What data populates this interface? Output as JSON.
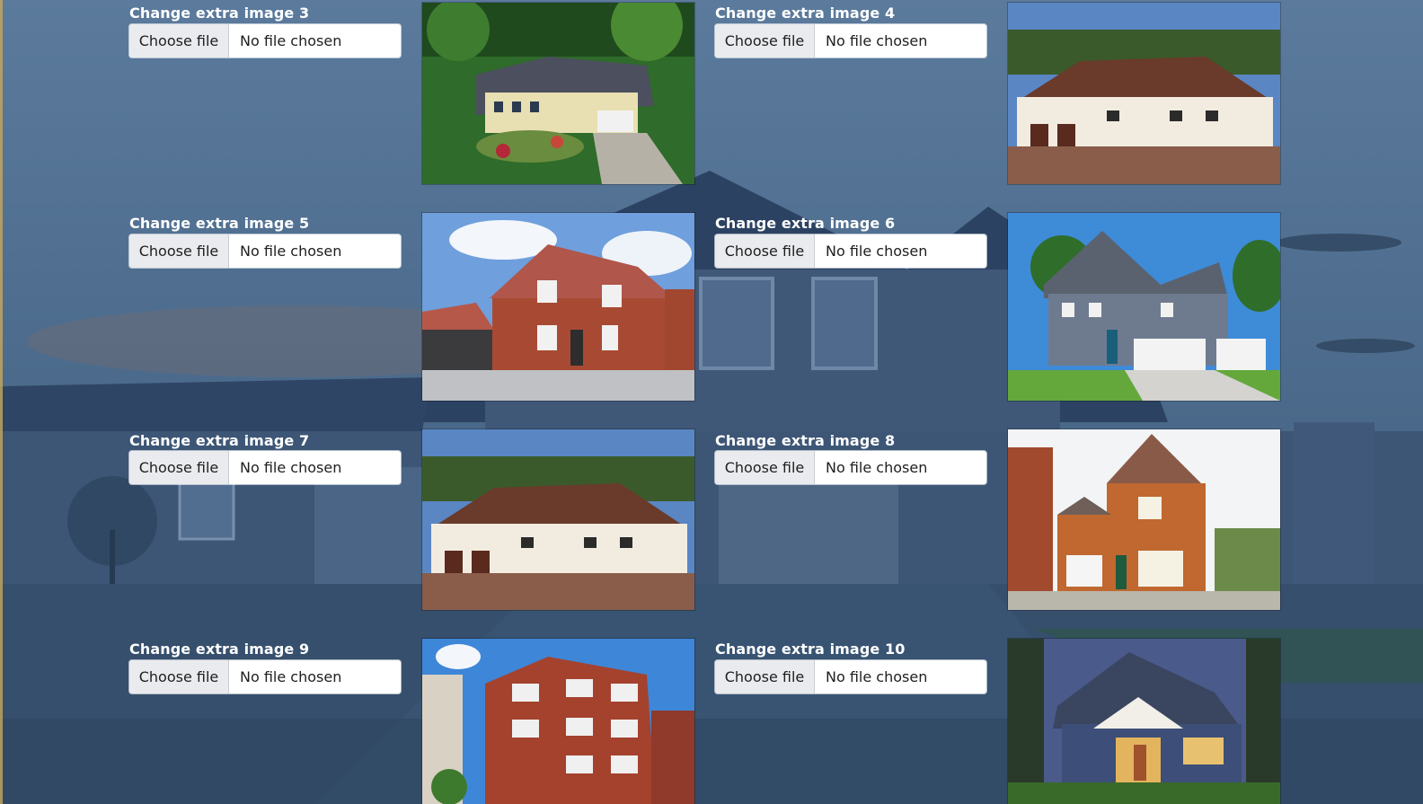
{
  "slots": [
    {
      "label": "Change extra image 3",
      "choose": "Choose file",
      "status": "No file chosen",
      "photo": "aerial-suburban-house"
    },
    {
      "label": "Change extra image 4",
      "choose": "Choose file",
      "status": "No file chosen",
      "photo": "white-tudor-house"
    },
    {
      "label": "Change extra image 5",
      "choose": "Choose file",
      "status": "No file chosen",
      "photo": "red-brick-house"
    },
    {
      "label": "Change extra image 6",
      "choose": "Choose file",
      "status": "No file chosen",
      "photo": "gray-siding-house"
    },
    {
      "label": "Change extra image 7",
      "choose": "Choose file",
      "status": "No file chosen",
      "photo": "white-tudor-house"
    },
    {
      "label": "Change extra image 8",
      "choose": "Choose file",
      "status": "No file chosen",
      "photo": "orange-brick-house"
    },
    {
      "label": "Change extra image 9",
      "choose": "Choose file",
      "status": "No file chosen",
      "photo": "brick-apartment-building"
    },
    {
      "label": "Change extra image 10",
      "choose": "Choose file",
      "status": "No file chosen",
      "photo": "craftsman-house-dusk"
    }
  ],
  "colors": {
    "label": "#ffffff",
    "overlay": "#35506e",
    "button": "#e9ebee"
  }
}
